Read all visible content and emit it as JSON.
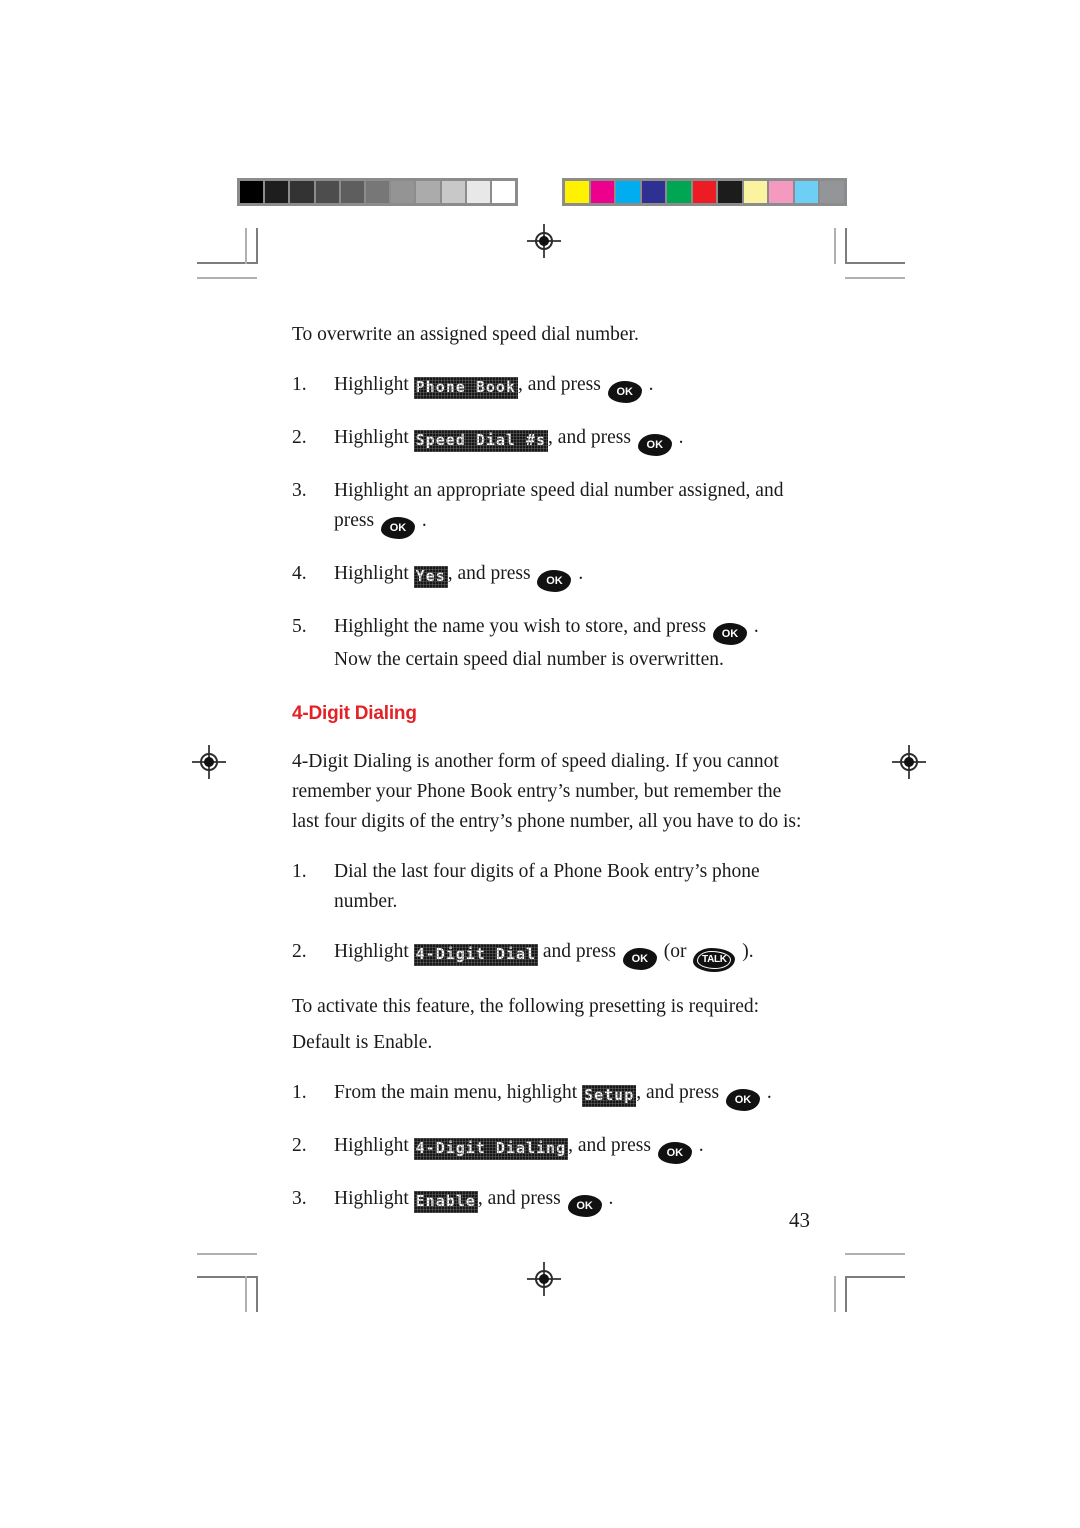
{
  "page": {
    "folio": "43"
  },
  "calibration": {
    "grayscale_label": "grayscale-step-wedge",
    "grayscale": [
      "#000000",
      "#1e1e1e",
      "#333333",
      "#4d4d4d",
      "#5e5e5e",
      "#777777",
      "#949494",
      "#ababab",
      "#c8c8c8",
      "#e8e8e8",
      "#ffffff"
    ],
    "color_label": "process-color-bar",
    "colors": [
      "#fff200",
      "#ec008c",
      "#00aeef",
      "#2e3192",
      "#00a651",
      "#ed1c24",
      "#1c1c1c",
      "#fbf3a0",
      "#f49ac1",
      "#6dcff6",
      "#939598"
    ]
  },
  "intro": {
    "text": "To overwrite an assigned speed dial number."
  },
  "overwrite_steps": [
    {
      "num": "1.",
      "pre": "Highlight ",
      "lcd": "Phone Book",
      "mid": ", and press ",
      "key": "OK",
      "post": " ."
    },
    {
      "num": "2.",
      "pre": "Highlight ",
      "lcd": "Speed Dial #s",
      "mid": ", and press ",
      "key": "OK",
      "post": " ."
    },
    {
      "num": "3.",
      "pre": "Highlight an appropriate speed dial number assigned, and press ",
      "key": "OK",
      "post": " ."
    },
    {
      "num": "4.",
      "pre": "Highlight ",
      "lcd": "Yes",
      "mid": ", and press ",
      "key": "OK",
      "post": " ."
    },
    {
      "num": "5.",
      "pre": "Highlight the name you wish to store, and press ",
      "key": "OK",
      "post": " .",
      "extra": "Now the certain speed dial number is overwritten."
    }
  ],
  "section": {
    "title": "4-Digit Dialing",
    "paragraph": "4-Digit Dialing is another form of speed dialing. If you cannot remember your Phone Book entry’s number, but remember the last four digits of the entry’s phone number, all you have to do is:"
  },
  "dialing_steps": [
    {
      "num": "1.",
      "pre": "Dial the last four digits of a Phone Book entry’s phone number."
    },
    {
      "num": "2.",
      "pre": "Highlight ",
      "lcd": "4-Digit Dial",
      "mid": " and press ",
      "key": "OK",
      "mid2": " (or ",
      "key2": "TALK",
      "post": " )."
    }
  ],
  "presetting": {
    "line1": "To activate this feature, the following presetting is required:",
    "line2": "Default is Enable."
  },
  "presetting_steps": [
    {
      "num": "1.",
      "pre": "From the main menu, highlight ",
      "lcd": "Setup",
      "mid": ", and press ",
      "key": "OK",
      "post": " ."
    },
    {
      "num": "2.",
      "pre": "Highlight ",
      "lcd": "4-Digit Dialing",
      "mid": ", and press ",
      "key": "OK",
      "post": " ."
    },
    {
      "num": "3.",
      "pre": "Highlight ",
      "lcd": "Enable",
      "mid": ", and press ",
      "key": "OK",
      "post": " ."
    }
  ]
}
